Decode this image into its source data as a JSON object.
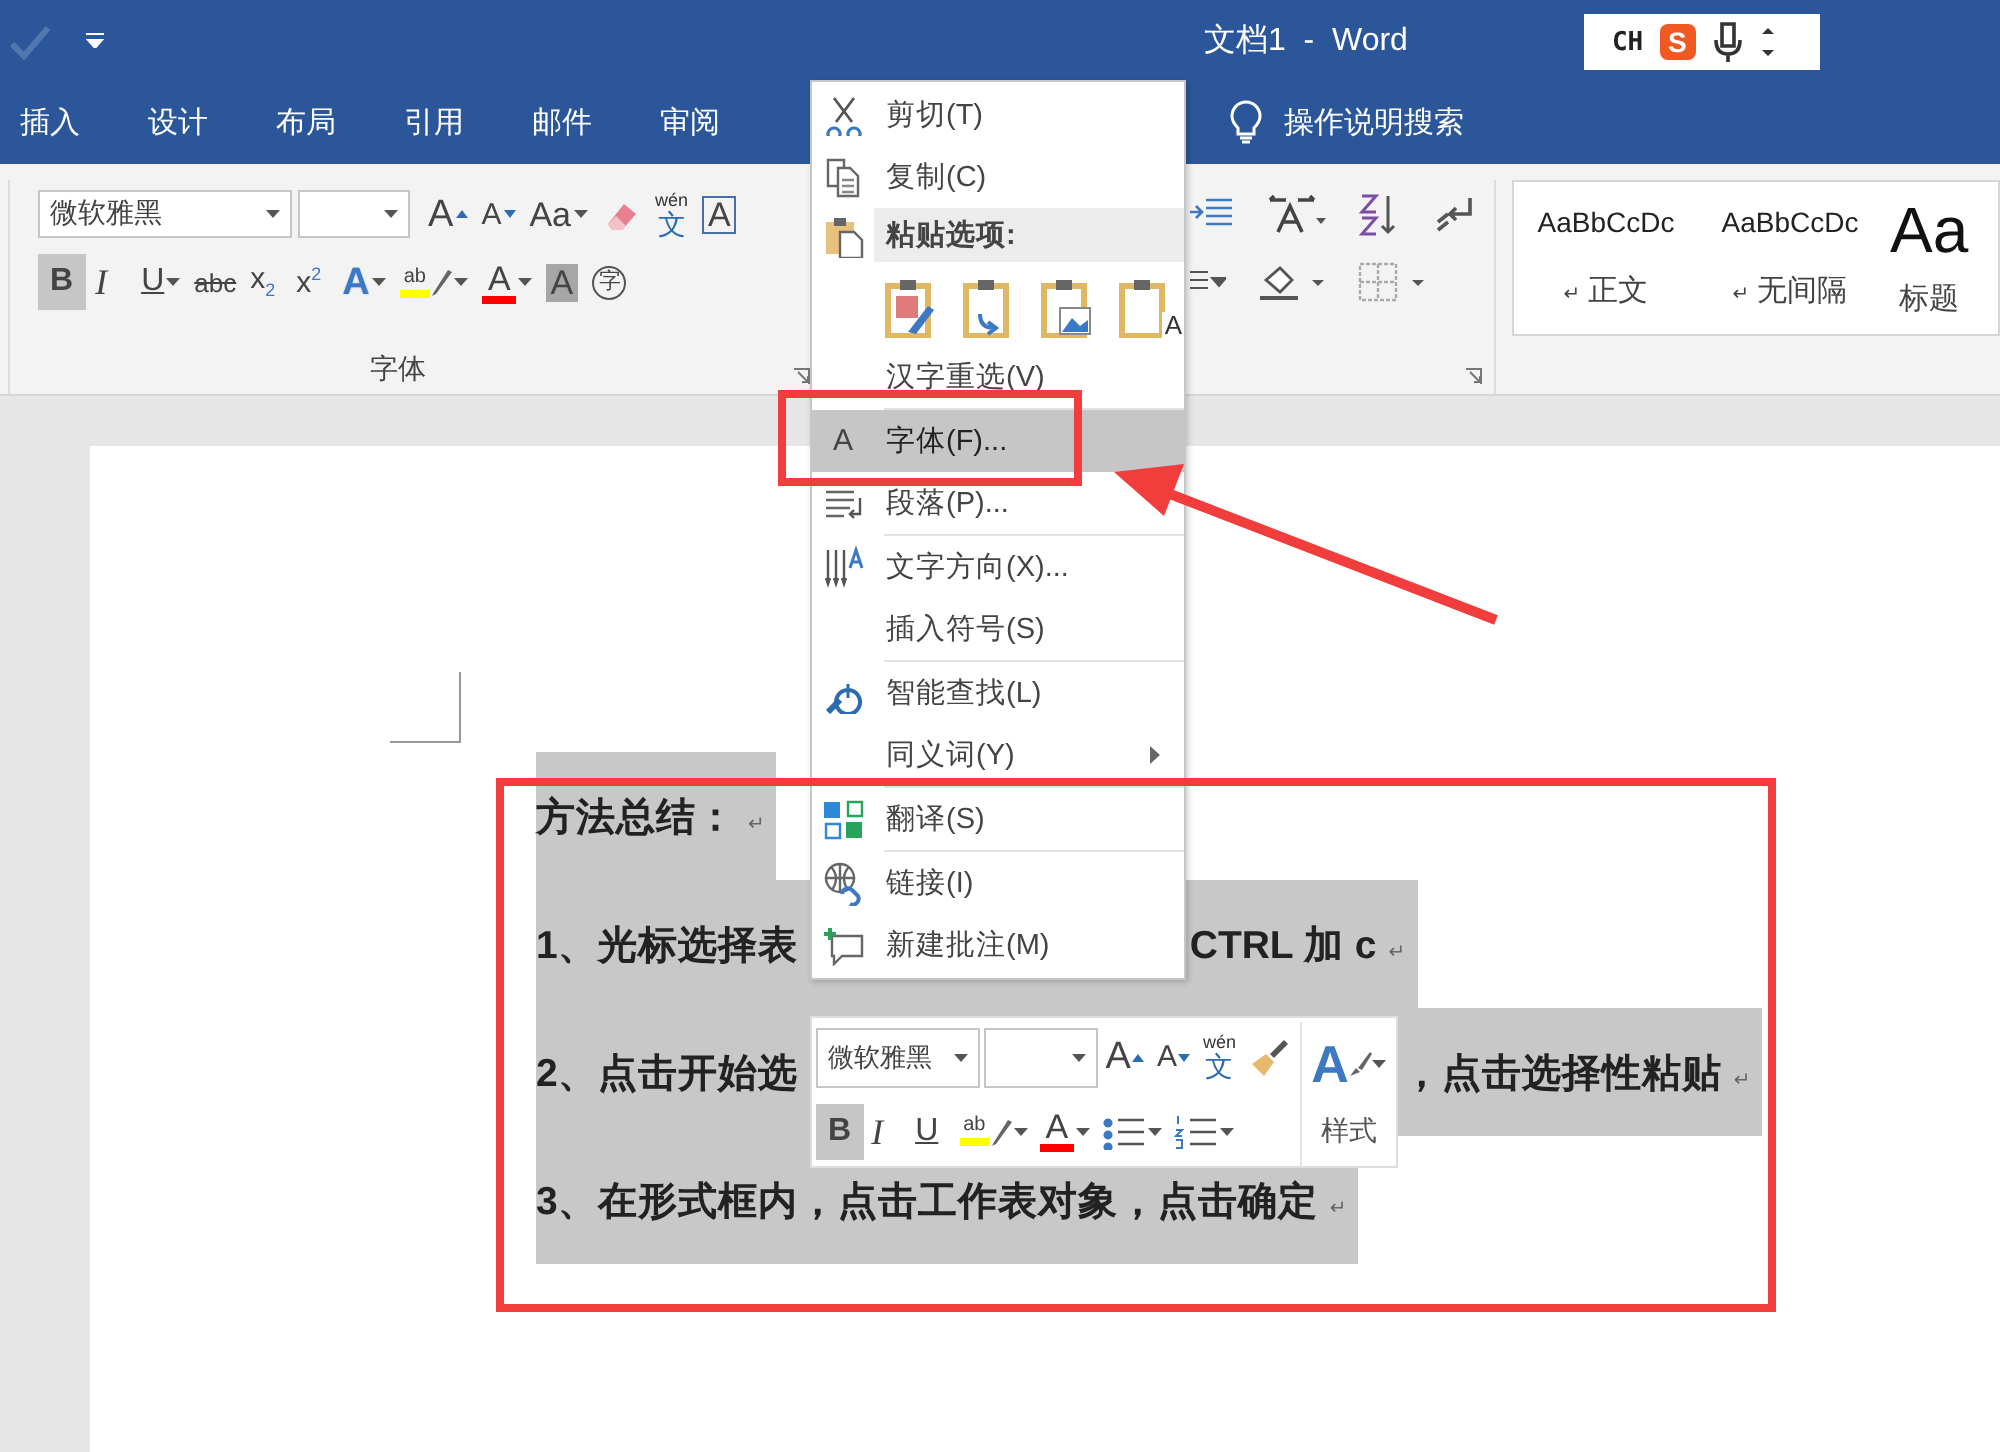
{
  "title_bar": {
    "title": "文档1  -  Word"
  },
  "ime": {
    "label": "CH",
    "logo": "S"
  },
  "tabs": [
    {
      "label": "插入",
      "selected": false
    },
    {
      "label": "设计",
      "selected": false
    },
    {
      "label": "布局",
      "selected": false
    },
    {
      "label": "引用",
      "selected": false
    },
    {
      "label": "邮件",
      "selected": false
    },
    {
      "label": "审阅",
      "selected": false
    }
  ],
  "tell_me": "操作说明搜索",
  "font_group": {
    "font_name": "微软雅黑",
    "label": "字体",
    "row1": [
      {
        "kind": "grow",
        "glyph": "A"
      },
      {
        "kind": "shrink",
        "glyph": "A"
      },
      {
        "kind": "case",
        "glyph": "Aa",
        "dropdown": true
      },
      {
        "kind": "clear"
      },
      {
        "kind": "phonetic",
        "glyph": "wén",
        "glyph2": "文"
      },
      {
        "kind": "border",
        "glyph": "A"
      }
    ],
    "row2": [
      {
        "kind": "bold",
        "glyph": "B",
        "selected": true
      },
      {
        "kind": "italic",
        "glyph": "I",
        "selected": false
      },
      {
        "kind": "underline",
        "glyph": "U",
        "selected": false,
        "dropdown": true
      },
      {
        "kind": "strike",
        "glyph": "abc",
        "selected": false
      },
      {
        "kind": "sub",
        "glyph": "x$_{2}$",
        "selected": false
      },
      {
        "kind": "sup",
        "glyph": "x$^{2}$",
        "selected": false
      },
      {
        "kind": "effects",
        "glyph": "A",
        "selected": false,
        "dropdown": true
      },
      {
        "kind": "highlight",
        "glyph": "ab",
        "selected": false,
        "dropdown": true
      },
      {
        "kind": "color",
        "glyph": "A",
        "selected": false,
        "dropdown": true
      },
      {
        "kind": "shade",
        "glyph": "A",
        "selected": false
      },
      {
        "kind": "enclose",
        "glyph": "字",
        "selected": false
      }
    ]
  },
  "styles": [
    {
      "preview": "AaBbCcDc",
      "mark": "↵",
      "name": "正文",
      "kind": "normal"
    },
    {
      "preview": "AaBbCcDc",
      "mark": "↵",
      "name": "无间隔",
      "kind": "normal"
    },
    {
      "preview": "Aa",
      "name": "标题",
      "kind": "heading"
    }
  ],
  "document": {
    "paragraphs": [
      {
        "segments": [
          "方法总结："
        ],
        "mark": "↵"
      },
      {
        "segments": [
          "1、光标选择表",
          "CTRL 加 c"
        ],
        "mark": "↵"
      },
      {
        "segments": [
          "2、点击开始选",
          "，点击选择性粘贴"
        ],
        "mark": "↵"
      },
      {
        "segments": [
          "3、在形式框内，点击工作表对象，点击确定"
        ],
        "mark": "↵"
      }
    ]
  },
  "context_menu": {
    "items": [
      {
        "kind": "cut",
        "label": "剪切(T)",
        "selected": false
      },
      {
        "kind": "copy",
        "label": "复制(C)",
        "selected": false
      },
      {
        "kind": "paste_header",
        "label": "粘贴选项:"
      },
      {
        "kind": "paste_options",
        "options": [
          {
            "kind": "keep_source"
          },
          {
            "kind": "merge"
          },
          {
            "kind": "picture"
          },
          {
            "kind": "text_only",
            "glyph": "A"
          }
        ]
      },
      {
        "kind": "plain",
        "label": "汉字重选(V)",
        "selected": false
      },
      {
        "kind": "font",
        "glyph": "A",
        "label": "字体(F)...",
        "selected": true,
        "divider_before": true
      },
      {
        "kind": "paragraph",
        "label": "段落(P)...",
        "selected": false
      },
      {
        "kind": "direction",
        "label": "文字方向(X)...",
        "selected": false,
        "divider_before": true
      },
      {
        "kind": "plain",
        "label": "插入符号(S)",
        "selected": false
      },
      {
        "kind": "lookup",
        "label": "智能查找(L)",
        "selected": false,
        "divider_before": true
      },
      {
        "kind": "plain",
        "label": "同义词(Y)",
        "selected": false,
        "submenu": true
      },
      {
        "kind": "translate",
        "label": "翻译(S)",
        "selected": false,
        "divider_before": true
      },
      {
        "kind": "link",
        "label": "链接(I)",
        "selected": false,
        "divider_before": true
      },
      {
        "kind": "comment",
        "label": "新建批注(M)",
        "selected": false
      }
    ]
  },
  "mini_toolbar": {
    "font_name": "微软雅黑",
    "styles_glyph": "A",
    "styles_label": "样式",
    "row1": [
      {
        "kind": "grow",
        "glyph": "A"
      },
      {
        "kind": "shrink",
        "glyph": "A"
      },
      {
        "kind": "phonetic",
        "glyph": "wén",
        "glyph2": "文"
      },
      {
        "kind": "painter"
      }
    ],
    "row2": [
      {
        "kind": "bold",
        "glyph": "B",
        "selected": true
      },
      {
        "kind": "italic",
        "glyph": "I",
        "selected": false
      },
      {
        "kind": "underline",
        "glyph": "U",
        "selected": false
      },
      {
        "kind": "highlight",
        "glyph": "ab",
        "selected": false,
        "dropdown": true
      },
      {
        "kind": "color",
        "glyph": "A",
        "selected": false,
        "dropdown": true
      },
      {
        "kind": "bullets",
        "selected": false,
        "dropdown": true
      },
      {
        "kind": "numbering",
        "selected": false,
        "dropdown": true
      }
    ]
  }
}
